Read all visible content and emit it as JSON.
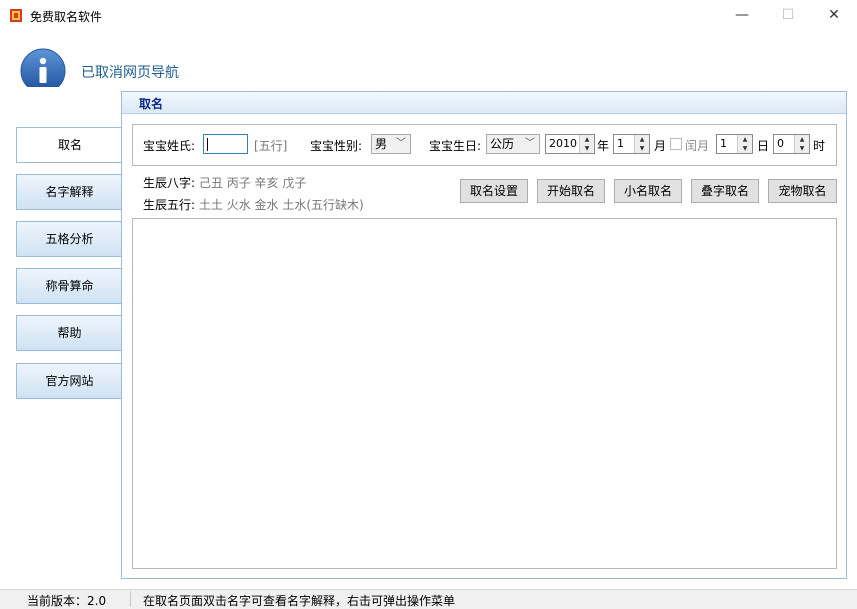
{
  "window": {
    "title": "免费取名软件",
    "minimize": "—",
    "maximize": "☐",
    "close": "✕"
  },
  "header": {
    "text": "已取消网页导航",
    "icon": "info-icon"
  },
  "sidebar": {
    "items": [
      {
        "label": "取名",
        "active": true
      },
      {
        "label": "名字解释"
      },
      {
        "label": "五格分析"
      },
      {
        "label": "称骨算命"
      },
      {
        "label": "帮助"
      },
      {
        "label": "官方网站"
      }
    ]
  },
  "panel": {
    "title": "取名",
    "form": {
      "surname_label": "宝宝姓氏:",
      "surname_value": "",
      "wuxing_tag": "[五行]",
      "gender_label": "宝宝性别:",
      "gender_value": "男",
      "birth_label": "宝宝生日:",
      "calendar_value": "公历",
      "year_value": "2010",
      "year_unit": "年",
      "month_value": "1",
      "month_unit": "月",
      "leap_label": "闰月",
      "day_value": "1",
      "day_unit": "日",
      "hour_value": "0",
      "hour_unit": "时"
    },
    "bazi_label": "生辰八字:",
    "bazi_value": "己丑 丙子 辛亥 戊子",
    "wuxing_label": "生辰五行:",
    "wuxing_value": "土土 火水 金水 土水(五行缺木)",
    "buttons": {
      "settings": "取名设置",
      "start": "开始取名",
      "nickname": "小名取名",
      "double": "叠字取名",
      "pet": "宠物取名"
    }
  },
  "status": {
    "version": "当前版本：2.0",
    "tip": "在取名页面双击名字可查看名字解释，右击可弹出操作菜单"
  },
  "colors": {
    "accent": "#1f5e8e",
    "panel_title": "#0a2a8a",
    "border": "#9bbcd8"
  }
}
